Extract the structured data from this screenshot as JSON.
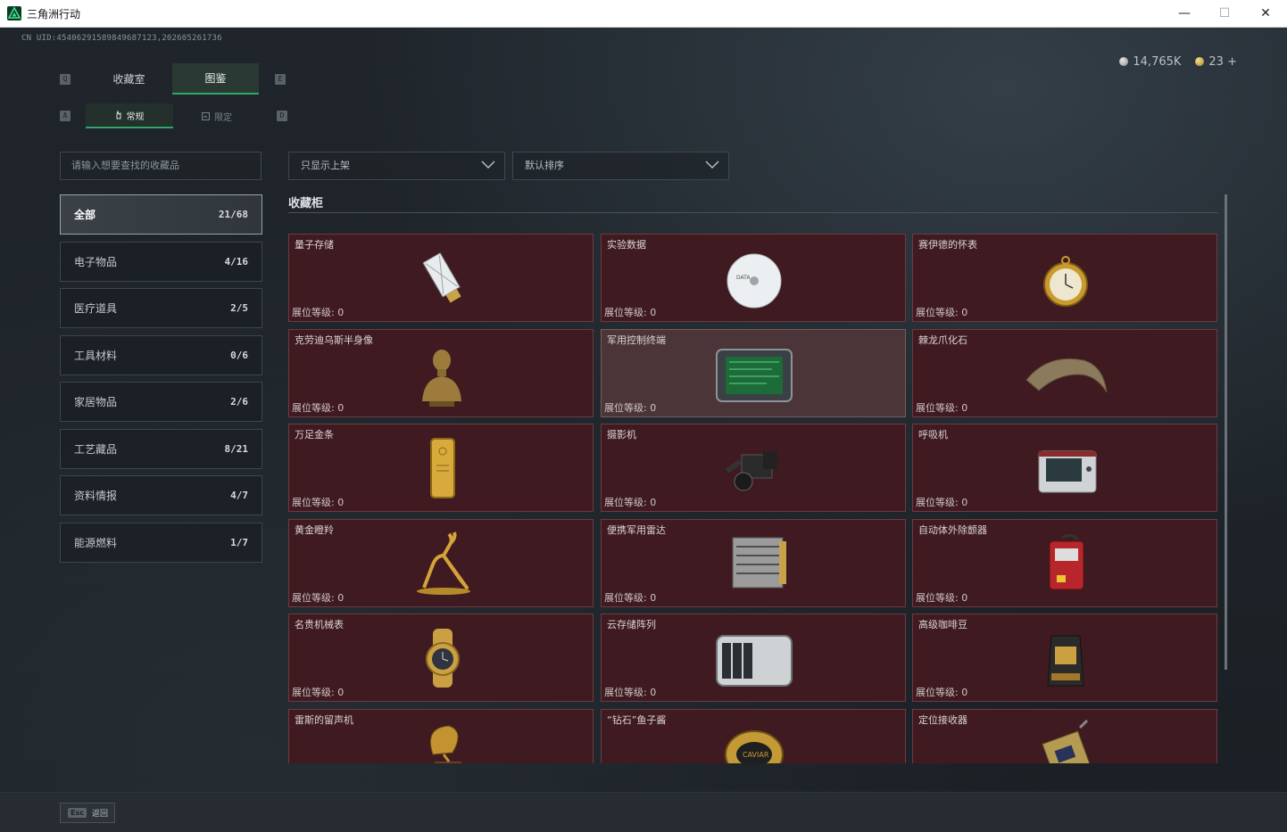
{
  "window": {
    "title": "三角洲行动",
    "minimize_glyph": "—",
    "maximize_glyph": "☐",
    "close_glyph": "✕"
  },
  "uid": "CN UID:454062915898496871​23,202605261736",
  "currency": {
    "silver": "14,765K",
    "gold": "23",
    "plus": "+"
  },
  "keys": {
    "left_tab": "Q",
    "right_tab": "E",
    "left_sub": "A",
    "right_sub": "D"
  },
  "tabs": [
    {
      "label": "收藏室",
      "active": false
    },
    {
      "label": "图鉴",
      "active": true
    }
  ],
  "subtabs": [
    {
      "label": "常规",
      "active": true,
      "icon": "hand-icon"
    },
    {
      "label": "限定",
      "active": false,
      "icon": "frame-icon"
    }
  ],
  "search": {
    "placeholder": "请输入想要查找的收藏品"
  },
  "filters": {
    "shelf": "只显示上架",
    "sort": "默认排序"
  },
  "categories": [
    {
      "label": "全部",
      "count": "21/68",
      "active": true
    },
    {
      "label": "电子物品",
      "count": "4/16"
    },
    {
      "label": "医疗道具",
      "count": "2/5"
    },
    {
      "label": "工具材料",
      "count": "0/6"
    },
    {
      "label": "家居物品",
      "count": "2/6"
    },
    {
      "label": "工艺藏品",
      "count": "8/21"
    },
    {
      "label": "资料情报",
      "count": "4/7"
    },
    {
      "label": "能源燃料",
      "count": "1/7"
    }
  ],
  "section_title": "收藏柜",
  "level_label": "展位等级: 0",
  "items": [
    {
      "name": "量子存储",
      "icon": "usb-drive-icon"
    },
    {
      "name": "实验数据",
      "icon": "disc-icon"
    },
    {
      "name": "赛伊德的怀表",
      "icon": "pocket-watch-icon"
    },
    {
      "name": "克劳迪乌斯半身像",
      "icon": "bust-icon"
    },
    {
      "name": "军用控制终端",
      "icon": "terminal-icon"
    },
    {
      "name": "棘龙爪化石",
      "icon": "claw-fossil-icon"
    },
    {
      "name": "万足金条",
      "icon": "gold-bar-icon"
    },
    {
      "name": "摄影机",
      "icon": "camera-icon"
    },
    {
      "name": "呼吸机",
      "icon": "ventilator-icon"
    },
    {
      "name": "黄金瞪羚",
      "icon": "gazelle-icon"
    },
    {
      "name": "便携军用雷达",
      "icon": "radar-icon"
    },
    {
      "name": "自动体外除颤器",
      "icon": "defibrillator-icon"
    },
    {
      "name": "名贵机械表",
      "icon": "wristwatch-icon"
    },
    {
      "name": "云存储阵列",
      "icon": "storage-array-icon"
    },
    {
      "name": "高级咖啡豆",
      "icon": "coffee-bag-icon"
    },
    {
      "name": "雷斯的留声机",
      "icon": "gramophone-icon"
    },
    {
      "name": "“钻石”鱼子酱",
      "icon": "caviar-tin-icon"
    },
    {
      "name": "定位接收器",
      "icon": "receiver-icon"
    }
  ],
  "footer": {
    "key": "Esc",
    "label": "返回"
  }
}
